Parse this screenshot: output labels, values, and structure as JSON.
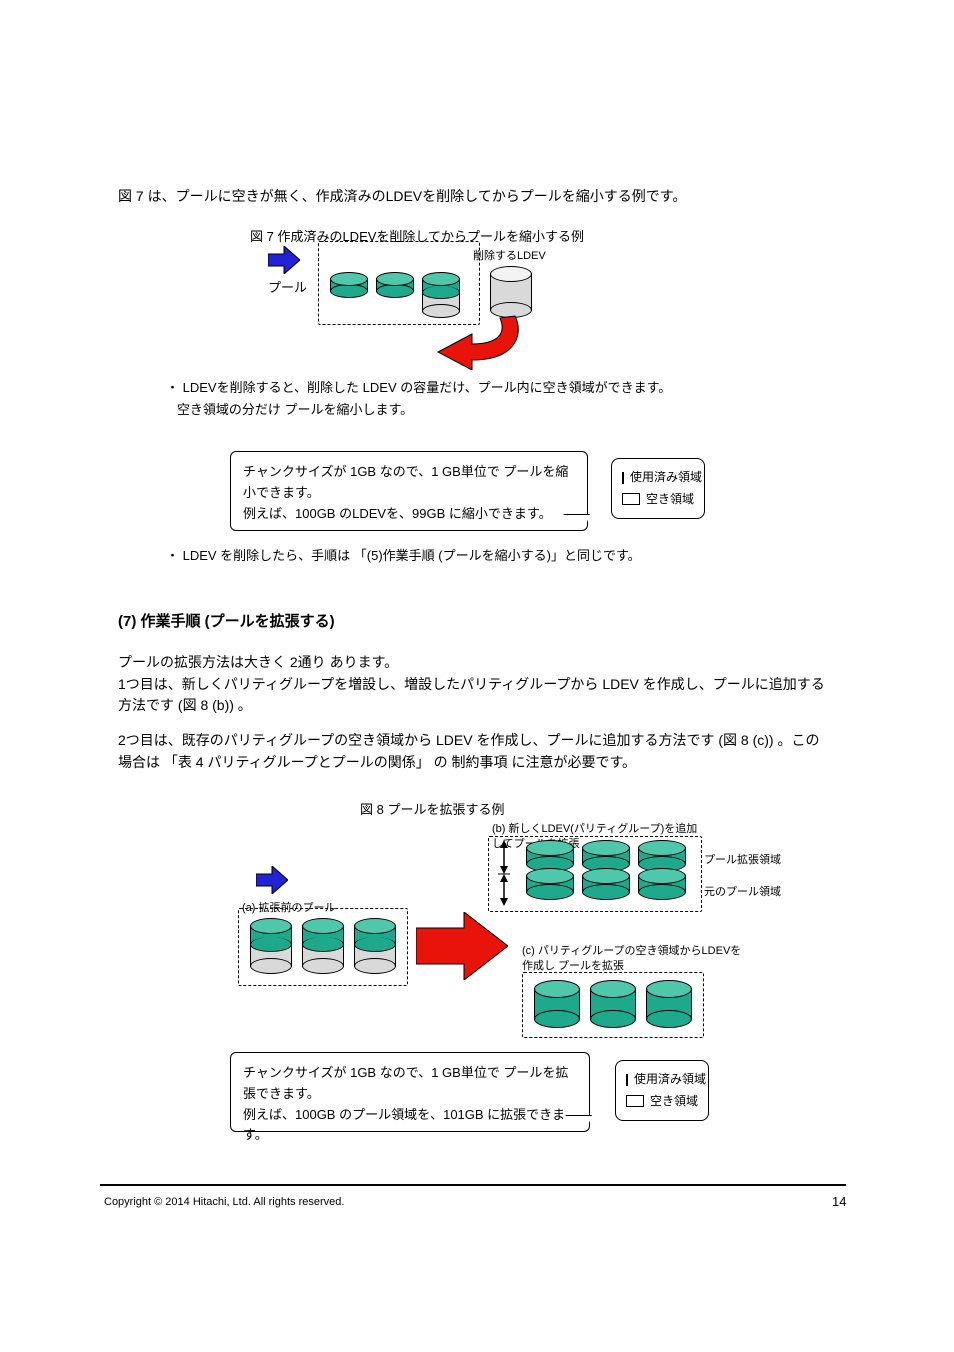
{
  "section1": {
    "caption_pre": "図",
    "caption_num": "7",
    "caption_post": "は、プールに空きが無く、作成済みのLDEVを削除してからプールを縮小する例です。",
    "fig_label": "図 7  作成済みのLDEVを削除してからプールを縮小する例",
    "pool_label": "プール",
    "delete_label": "削除するLDEV",
    "bullet1": "チャンクサイズが 1GB なので、1 GB単位で プールを縮小できます。",
    "bullet2": "例えば、100GB のLDEVを、99GB に縮小できます。",
    "legend_used": "使用済み領域",
    "legend_free": "空き領域",
    "followup": "・ LDEV を削除したら、手順は 「(5)作業手順 (プールを縮小する)」と同じです。"
  },
  "section2": {
    "heading": "(7) 作業手順 (プールを拡張する)",
    "para1_a": "プールの拡張方法は大きく 2通り あります。",
    "para1_b": "1つ目は、新しくパリティグループを増設し、増設したパリティグループから LDEV を作成し、プールに追加する方法です (",
    "para1_c": "図 8",
    "para1_d": " (b)) 。",
    "para2_a": "2つ目は、既存のパリティグループの空き領域から LDEV を作成し、プールに追加する方法です (",
    "para2_b": "図 8",
    "para2_c": " (c)) 。この場合は ",
    "para2_d": "「表 4  パリティグループとプールの関係」",
    "para2_e": " の 制約事項 に注意が必要です。",
    "fig_label": "図 8  プールを拡張する例",
    "fig_a_label": "(a) 拡張前のプール",
    "fig_b_label1": "(b) 新しくLDEV(パリティグループ)を追加",
    "fig_b_label2": "      してプールを拡張",
    "fig_b_oldpool": "元のプール領域",
    "fig_b_newpool": "プール拡張領域",
    "fig_c_label1": "(c) パリティグループの空き領域からLDEVを",
    "fig_c_label2": "      作成し プールを拡張",
    "bullet1": "チャンクサイズが 1GB なので、1 GB単位で プールを拡張できます。",
    "bullet2": "例えば、100GB のプール領域を、101GB に拡張できます。",
    "legend_used": "使用済み領域",
    "legend_free": "空き領域"
  },
  "footer": {
    "copyright": "Copyright © 2014 Hitachi, Ltd. All rights reserved.",
    "page": "14"
  },
  "colors": {
    "teal": "#1fa98c",
    "teal_light": "#4fc7ab",
    "grey_top": "#f3f3f3",
    "grey_side": "#d9d9d9",
    "blue": "#2222d6",
    "red": "#e8140a"
  }
}
